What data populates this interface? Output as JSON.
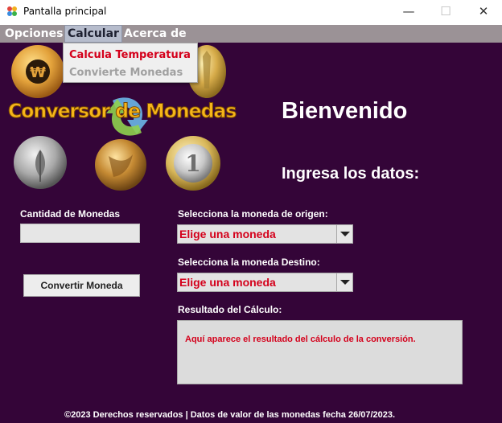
{
  "window": {
    "title": "Pantalla principal",
    "minimize": "—",
    "maximize": "☐",
    "close": "✕"
  },
  "menu": {
    "items": [
      "Opciones",
      "Calcular",
      "Acerca de"
    ],
    "active": "Calcular"
  },
  "dropdown": {
    "items": [
      {
        "label": "Calcula Temperatura",
        "color": "#d4001b"
      },
      {
        "label": "Convierte Monedas",
        "color": "#a0a0a0"
      }
    ]
  },
  "main": {
    "logo_text": "Conversor de Monedas",
    "welcome": "Bienvenido",
    "prompt": "Ingresa los datos:",
    "amount_label": "Cantidad de Monedas",
    "amount_value": "",
    "origin_label": "Selecciona la moneda de origen:",
    "origin_value": "Elige una moneda",
    "dest_label": "Selecciona la moneda Destino:",
    "dest_value": "Elige una moneda",
    "convert_button": "Convertir Moneda",
    "result_label": "Resultado del Cálculo:",
    "result_text": "Aquí aparece el resultado del cálculo de la conversión."
  },
  "footer": "©2023 Derechos reservados | Datos de valor de las monedas fecha 26/07/2023.",
  "colors": {
    "background": "#340538",
    "menubar": "#9b9296",
    "accent_red": "#d4001b",
    "logo_gold": "#f6b51a"
  },
  "icons": {
    "app": "app-logo-icon",
    "coins": [
      "won-coin-icon",
      "dollar-coin-icon",
      "yen-coin-icon",
      "peso-coin-icon",
      "euro-coin-icon",
      "exchange-arrow-icon"
    ]
  }
}
